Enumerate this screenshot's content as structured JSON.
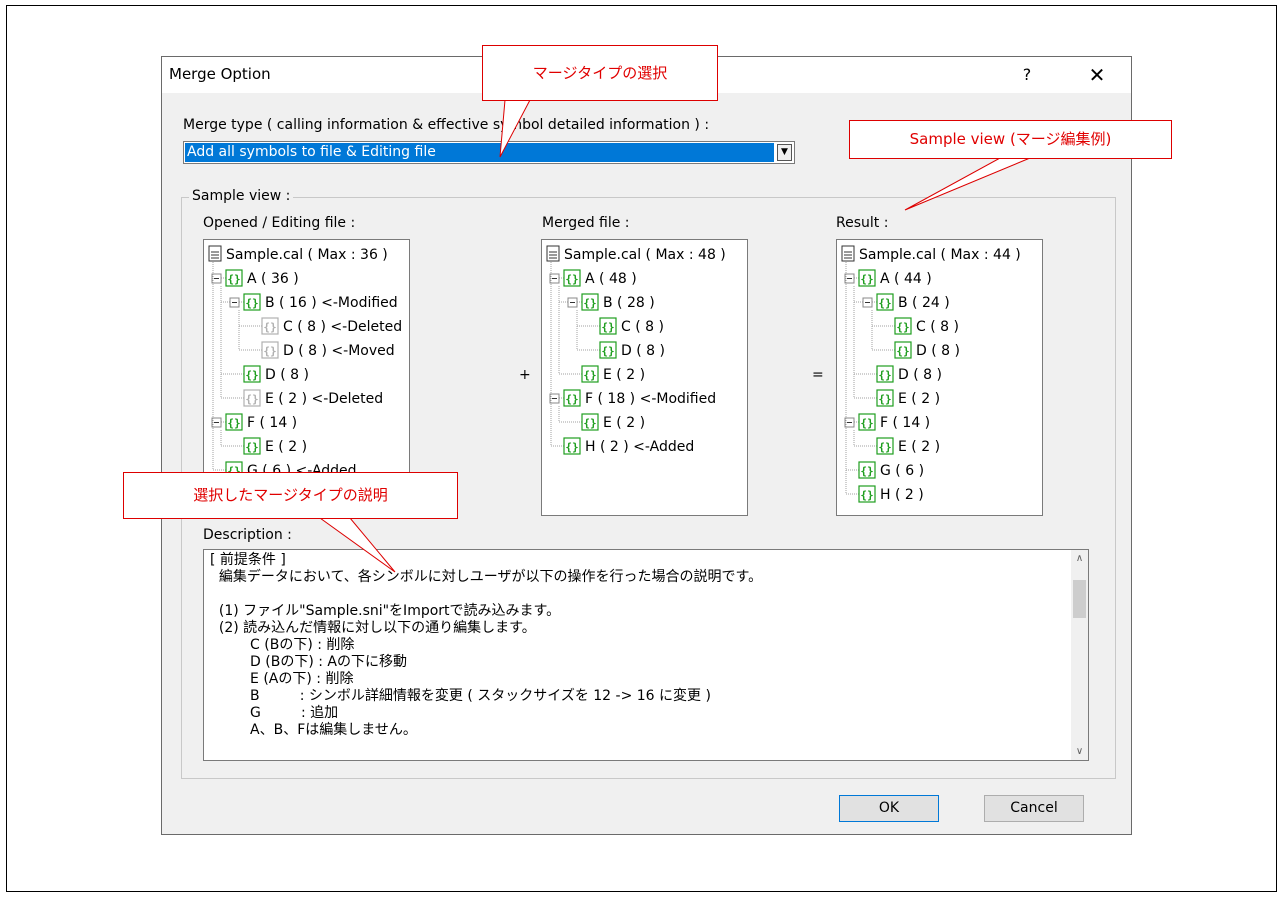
{
  "dialog": {
    "title": "Merge Option",
    "help_label": "?",
    "close_label": "✕",
    "merge_type_label": "Merge type ( calling information & effective symbol detailed information ) :",
    "merge_type_value": "Add all symbols to file & Editing file",
    "sample_view_label": "Sample view :",
    "opened_label": "Opened / Editing file :",
    "merged_label": "Merged file :",
    "result_label": "Result :",
    "plus": "+",
    "equals": "=",
    "description_label": "Description :",
    "ok_label": "OK",
    "cancel_label": "Cancel"
  },
  "trees": {
    "opened": [
      {
        "text": "Sample.cal ( Max : 36 )",
        "depth": 0,
        "icon": "file"
      },
      {
        "text": "A ( 36 )",
        "depth": 1,
        "icon": "green",
        "toggle": true
      },
      {
        "text": "B ( 16 ) <-Modified",
        "depth": 2,
        "icon": "green",
        "toggle": true
      },
      {
        "text": "C ( 8 ) <-Deleted",
        "depth": 3,
        "icon": "gray"
      },
      {
        "text": "D ( 8 ) <-Moved",
        "depth": 3,
        "icon": "gray"
      },
      {
        "text": "D ( 8 )",
        "depth": 2,
        "icon": "green"
      },
      {
        "text": "E ( 2 ) <-Deleted",
        "depth": 2,
        "icon": "gray"
      },
      {
        "text": "F ( 14 )",
        "depth": 1,
        "icon": "green",
        "toggle": true
      },
      {
        "text": "E ( 2 )",
        "depth": 2,
        "icon": "green"
      },
      {
        "text": "G ( 6 ) <-Added",
        "depth": 1,
        "icon": "green"
      }
    ],
    "merged": [
      {
        "text": "Sample.cal ( Max : 48 )",
        "depth": 0,
        "icon": "file"
      },
      {
        "text": "A ( 48 )",
        "depth": 1,
        "icon": "green",
        "toggle": true
      },
      {
        "text": "B ( 28 )",
        "depth": 2,
        "icon": "green",
        "toggle": true
      },
      {
        "text": "C ( 8 )",
        "depth": 3,
        "icon": "green"
      },
      {
        "text": "D ( 8 )",
        "depth": 3,
        "icon": "green"
      },
      {
        "text": "E ( 2 )",
        "depth": 2,
        "icon": "green"
      },
      {
        "text": "F ( 18 ) <-Modified",
        "depth": 1,
        "icon": "green",
        "toggle": true
      },
      {
        "text": "E ( 2 )",
        "depth": 2,
        "icon": "green"
      },
      {
        "text": "H ( 2 ) <-Added",
        "depth": 1,
        "icon": "green"
      }
    ],
    "result": [
      {
        "text": "Sample.cal ( Max : 44 )",
        "depth": 0,
        "icon": "file"
      },
      {
        "text": "A ( 44 )",
        "depth": 1,
        "icon": "green",
        "toggle": true
      },
      {
        "text": "B ( 24 )",
        "depth": 2,
        "icon": "green",
        "toggle": true
      },
      {
        "text": "C ( 8 )",
        "depth": 3,
        "icon": "green"
      },
      {
        "text": "D ( 8 )",
        "depth": 3,
        "icon": "green"
      },
      {
        "text": "D ( 8 )",
        "depth": 2,
        "icon": "green"
      },
      {
        "text": "E ( 2 )",
        "depth": 2,
        "icon": "green"
      },
      {
        "text": "F ( 14 )",
        "depth": 1,
        "icon": "green",
        "toggle": true
      },
      {
        "text": "E ( 2 )",
        "depth": 2,
        "icon": "green"
      },
      {
        "text": "G ( 6 )",
        "depth": 1,
        "icon": "green"
      },
      {
        "text": "H ( 2 )",
        "depth": 1,
        "icon": "green"
      }
    ]
  },
  "description_lines": [
    "[ 前提条件 ]",
    "  編集データにおいて、各シンボルに対しユーザが以下の操作を行った場合の説明です。",
    "",
    "  (1) ファイル\"Sample.sni\"をImportで読み込みます。",
    "  (2) 読み込んだ情報に対し以下の通り編集します。",
    "         C (Bの下) : 削除",
    "         D (Bの下) : Aの下に移動",
    "         E (Aの下) : 削除",
    "         B         : シンボル詳細情報を変更 ( スタックサイズを 12 -> 16 に変更 )",
    "         G         : 追加",
    "         A、B、Fは編集しません。"
  ],
  "callouts": {
    "merge_type": "マージタイプの選択",
    "sample_view": "Sample view (マージ編集例)",
    "description": "選択したマージタイプの説明"
  },
  "colors": {
    "accent": "#0078d7",
    "callout": "#e00000",
    "icon_green": "#1e9e1e",
    "icon_gray": "#b0b0b0"
  }
}
